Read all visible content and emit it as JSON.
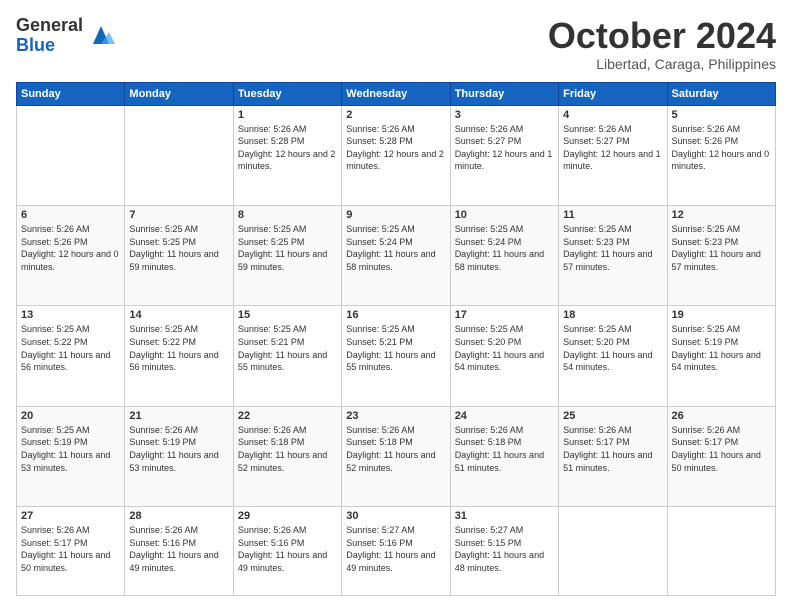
{
  "header": {
    "logo_line1": "General",
    "logo_line2": "Blue",
    "month": "October 2024",
    "location": "Libertad, Caraga, Philippines"
  },
  "weekdays": [
    "Sunday",
    "Monday",
    "Tuesday",
    "Wednesday",
    "Thursday",
    "Friday",
    "Saturday"
  ],
  "weeks": [
    [
      {
        "day": "",
        "empty": true
      },
      {
        "day": "",
        "empty": true
      },
      {
        "day": "1",
        "sunrise": "Sunrise: 5:26 AM",
        "sunset": "Sunset: 5:28 PM",
        "daylight": "Daylight: 12 hours and 2 minutes."
      },
      {
        "day": "2",
        "sunrise": "Sunrise: 5:26 AM",
        "sunset": "Sunset: 5:28 PM",
        "daylight": "Daylight: 12 hours and 2 minutes."
      },
      {
        "day": "3",
        "sunrise": "Sunrise: 5:26 AM",
        "sunset": "Sunset: 5:27 PM",
        "daylight": "Daylight: 12 hours and 1 minute."
      },
      {
        "day": "4",
        "sunrise": "Sunrise: 5:26 AM",
        "sunset": "Sunset: 5:27 PM",
        "daylight": "Daylight: 12 hours and 1 minute."
      },
      {
        "day": "5",
        "sunrise": "Sunrise: 5:26 AM",
        "sunset": "Sunset: 5:26 PM",
        "daylight": "Daylight: 12 hours and 0 minutes."
      }
    ],
    [
      {
        "day": "6",
        "sunrise": "Sunrise: 5:26 AM",
        "sunset": "Sunset: 5:26 PM",
        "daylight": "Daylight: 12 hours and 0 minutes."
      },
      {
        "day": "7",
        "sunrise": "Sunrise: 5:25 AM",
        "sunset": "Sunset: 5:25 PM",
        "daylight": "Daylight: 11 hours and 59 minutes."
      },
      {
        "day": "8",
        "sunrise": "Sunrise: 5:25 AM",
        "sunset": "Sunset: 5:25 PM",
        "daylight": "Daylight: 11 hours and 59 minutes."
      },
      {
        "day": "9",
        "sunrise": "Sunrise: 5:25 AM",
        "sunset": "Sunset: 5:24 PM",
        "daylight": "Daylight: 11 hours and 58 minutes."
      },
      {
        "day": "10",
        "sunrise": "Sunrise: 5:25 AM",
        "sunset": "Sunset: 5:24 PM",
        "daylight": "Daylight: 11 hours and 58 minutes."
      },
      {
        "day": "11",
        "sunrise": "Sunrise: 5:25 AM",
        "sunset": "Sunset: 5:23 PM",
        "daylight": "Daylight: 11 hours and 57 minutes."
      },
      {
        "day": "12",
        "sunrise": "Sunrise: 5:25 AM",
        "sunset": "Sunset: 5:23 PM",
        "daylight": "Daylight: 11 hours and 57 minutes."
      }
    ],
    [
      {
        "day": "13",
        "sunrise": "Sunrise: 5:25 AM",
        "sunset": "Sunset: 5:22 PM",
        "daylight": "Daylight: 11 hours and 56 minutes."
      },
      {
        "day": "14",
        "sunrise": "Sunrise: 5:25 AM",
        "sunset": "Sunset: 5:22 PM",
        "daylight": "Daylight: 11 hours and 56 minutes."
      },
      {
        "day": "15",
        "sunrise": "Sunrise: 5:25 AM",
        "sunset": "Sunset: 5:21 PM",
        "daylight": "Daylight: 11 hours and 55 minutes."
      },
      {
        "day": "16",
        "sunrise": "Sunrise: 5:25 AM",
        "sunset": "Sunset: 5:21 PM",
        "daylight": "Daylight: 11 hours and 55 minutes."
      },
      {
        "day": "17",
        "sunrise": "Sunrise: 5:25 AM",
        "sunset": "Sunset: 5:20 PM",
        "daylight": "Daylight: 11 hours and 54 minutes."
      },
      {
        "day": "18",
        "sunrise": "Sunrise: 5:25 AM",
        "sunset": "Sunset: 5:20 PM",
        "daylight": "Daylight: 11 hours and 54 minutes."
      },
      {
        "day": "19",
        "sunrise": "Sunrise: 5:25 AM",
        "sunset": "Sunset: 5:19 PM",
        "daylight": "Daylight: 11 hours and 54 minutes."
      }
    ],
    [
      {
        "day": "20",
        "sunrise": "Sunrise: 5:25 AM",
        "sunset": "Sunset: 5:19 PM",
        "daylight": "Daylight: 11 hours and 53 minutes."
      },
      {
        "day": "21",
        "sunrise": "Sunrise: 5:26 AM",
        "sunset": "Sunset: 5:19 PM",
        "daylight": "Daylight: 11 hours and 53 minutes."
      },
      {
        "day": "22",
        "sunrise": "Sunrise: 5:26 AM",
        "sunset": "Sunset: 5:18 PM",
        "daylight": "Daylight: 11 hours and 52 minutes."
      },
      {
        "day": "23",
        "sunrise": "Sunrise: 5:26 AM",
        "sunset": "Sunset: 5:18 PM",
        "daylight": "Daylight: 11 hours and 52 minutes."
      },
      {
        "day": "24",
        "sunrise": "Sunrise: 5:26 AM",
        "sunset": "Sunset: 5:18 PM",
        "daylight": "Daylight: 11 hours and 51 minutes."
      },
      {
        "day": "25",
        "sunrise": "Sunrise: 5:26 AM",
        "sunset": "Sunset: 5:17 PM",
        "daylight": "Daylight: 11 hours and 51 minutes."
      },
      {
        "day": "26",
        "sunrise": "Sunrise: 5:26 AM",
        "sunset": "Sunset: 5:17 PM",
        "daylight": "Daylight: 11 hours and 50 minutes."
      }
    ],
    [
      {
        "day": "27",
        "sunrise": "Sunrise: 5:26 AM",
        "sunset": "Sunset: 5:17 PM",
        "daylight": "Daylight: 11 hours and 50 minutes."
      },
      {
        "day": "28",
        "sunrise": "Sunrise: 5:26 AM",
        "sunset": "Sunset: 5:16 PM",
        "daylight": "Daylight: 11 hours and 49 minutes."
      },
      {
        "day": "29",
        "sunrise": "Sunrise: 5:26 AM",
        "sunset": "Sunset: 5:16 PM",
        "daylight": "Daylight: 11 hours and 49 minutes."
      },
      {
        "day": "30",
        "sunrise": "Sunrise: 5:27 AM",
        "sunset": "Sunset: 5:16 PM",
        "daylight": "Daylight: 11 hours and 49 minutes."
      },
      {
        "day": "31",
        "sunrise": "Sunrise: 5:27 AM",
        "sunset": "Sunset: 5:15 PM",
        "daylight": "Daylight: 11 hours and 48 minutes."
      },
      {
        "day": "",
        "empty": true
      },
      {
        "day": "",
        "empty": true
      }
    ]
  ]
}
